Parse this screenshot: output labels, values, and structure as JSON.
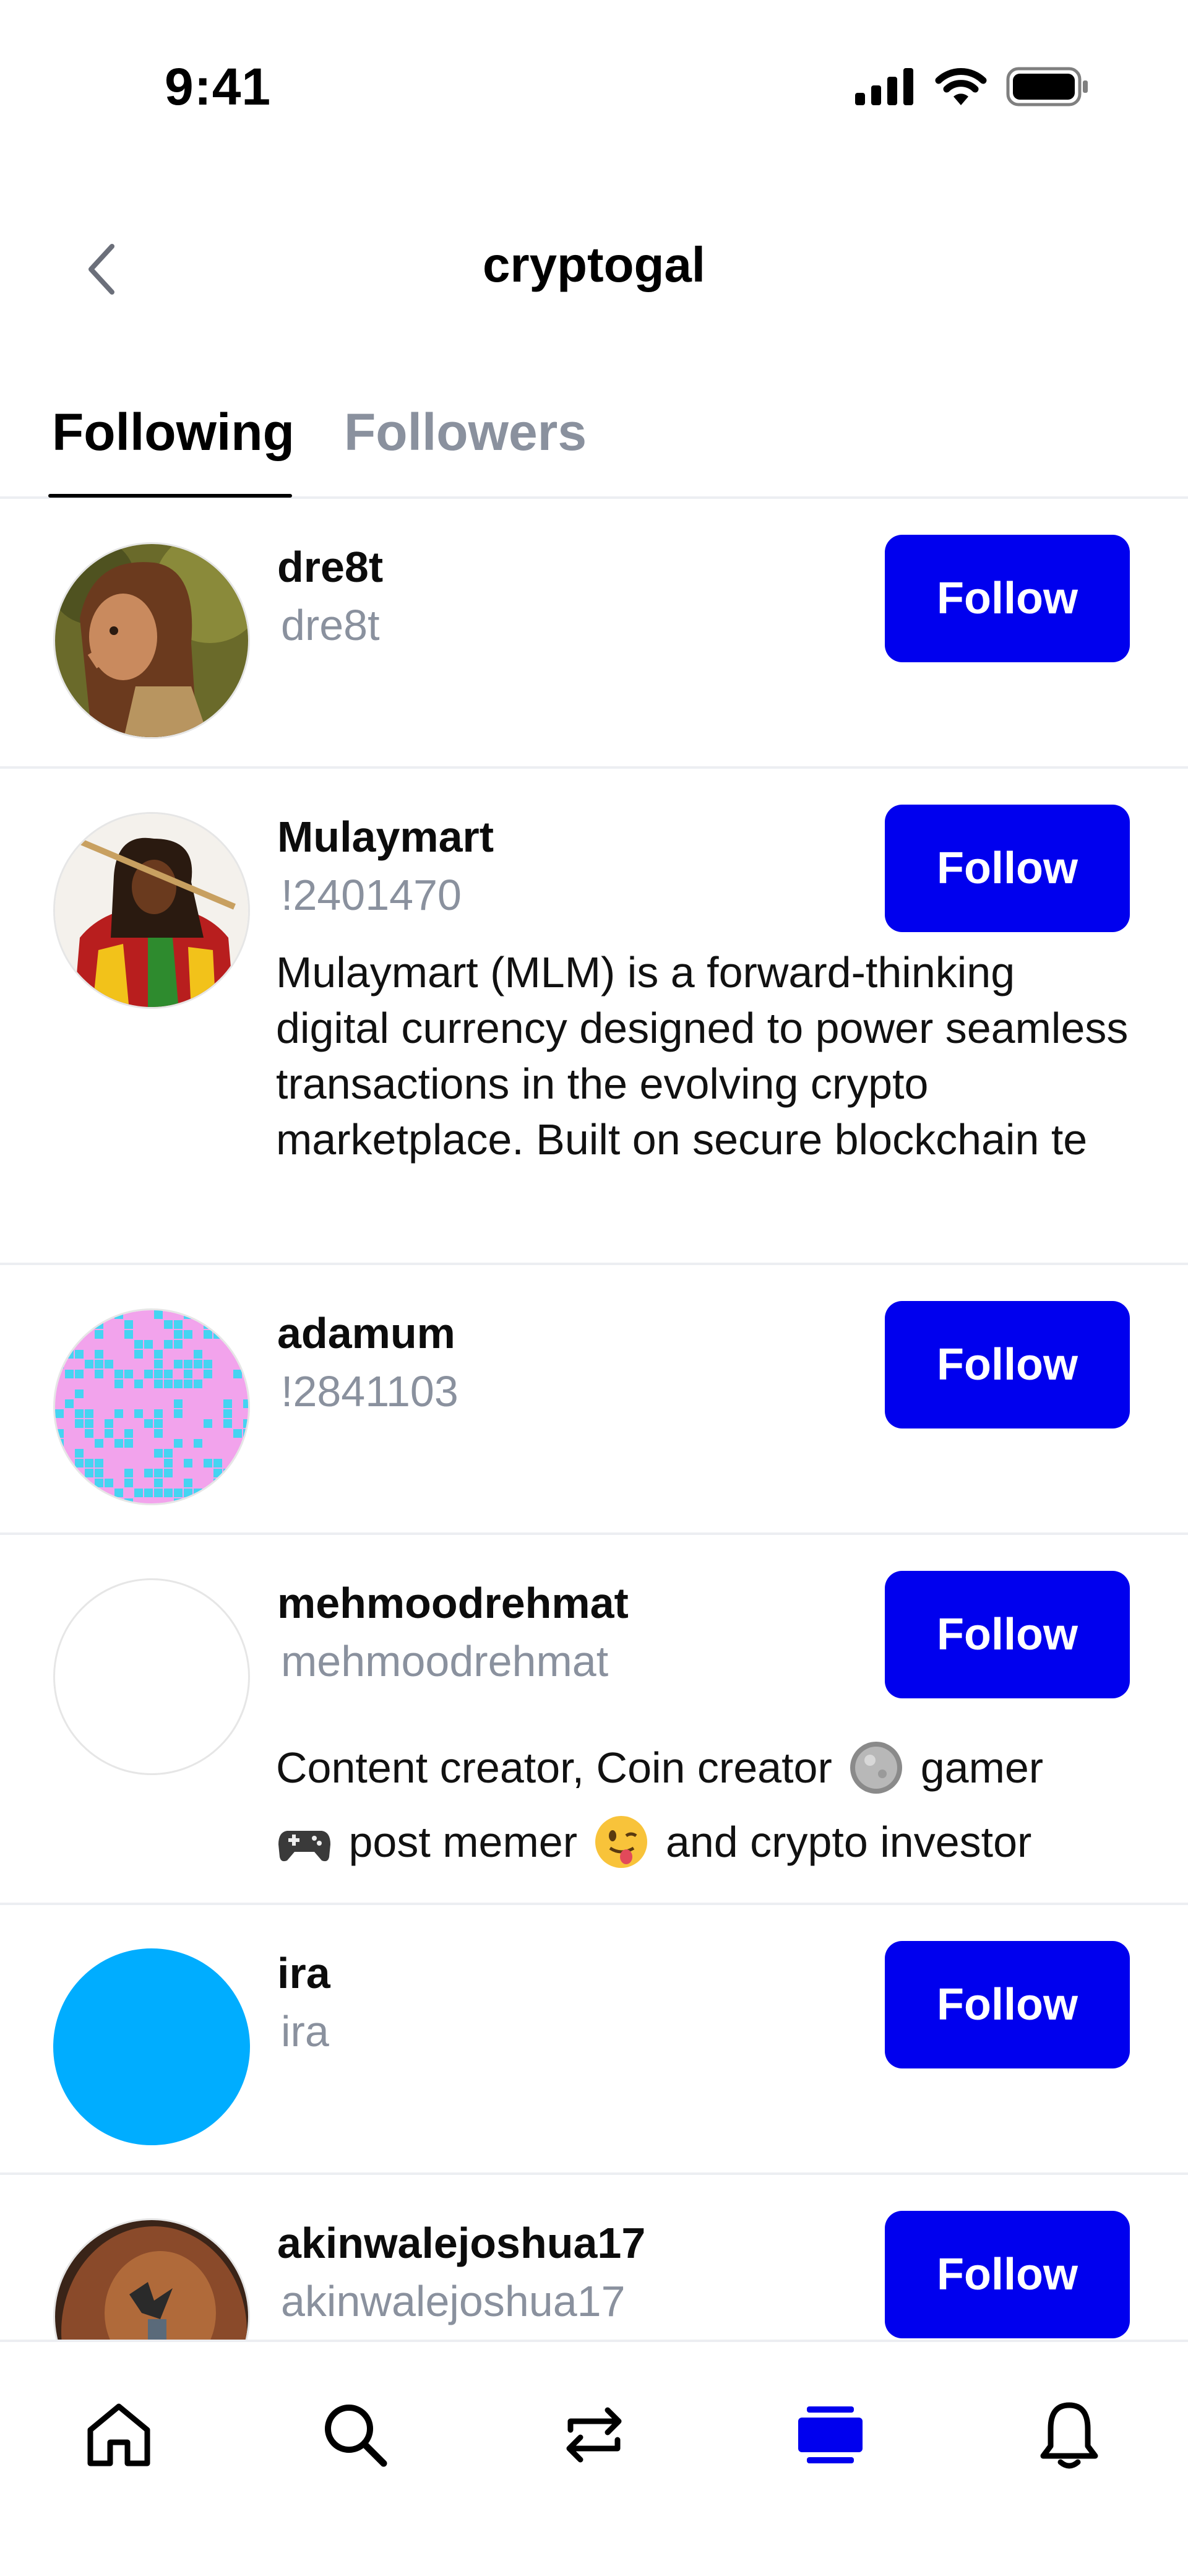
{
  "status_bar": {
    "time": "9:41"
  },
  "header": {
    "title": "cryptogal"
  },
  "tabs": [
    {
      "label": "Following",
      "active": true
    },
    {
      "label": "Followers",
      "active": false
    }
  ],
  "rows": [
    {
      "name": "dre8t",
      "handle": "dre8t",
      "button": "Follow"
    },
    {
      "name": "Mulaymart",
      "handle": "!2401470",
      "button": "Follow",
      "bio": "Mulaymart (MLM) is a forward-thinking digital currency designed to power seamless transactions in the evolving crypto marketplace. Built on secure blockchain te"
    },
    {
      "name": "adamum",
      "handle": "!2841103",
      "button": "Follow"
    },
    {
      "name": "mehmoodrehmat",
      "handle": "mehmoodrehmat",
      "button": "Follow",
      "bio_parts": [
        "Content creator, Coin creator",
        "gamer",
        "post memer",
        "and crypto investor"
      ]
    },
    {
      "name": "ira",
      "handle": "ira",
      "button": "Follow"
    },
    {
      "name": "akinwalejoshua17",
      "handle": "akinwalejoshua17",
      "button": "Follow"
    }
  ],
  "nav": [
    "home-icon",
    "search-icon",
    "swap-icon",
    "feed-icon",
    "bell-icon"
  ],
  "colors": {
    "accent": "#0000ee",
    "muted": "#8a919e",
    "ira_avatar": "#00adff"
  }
}
